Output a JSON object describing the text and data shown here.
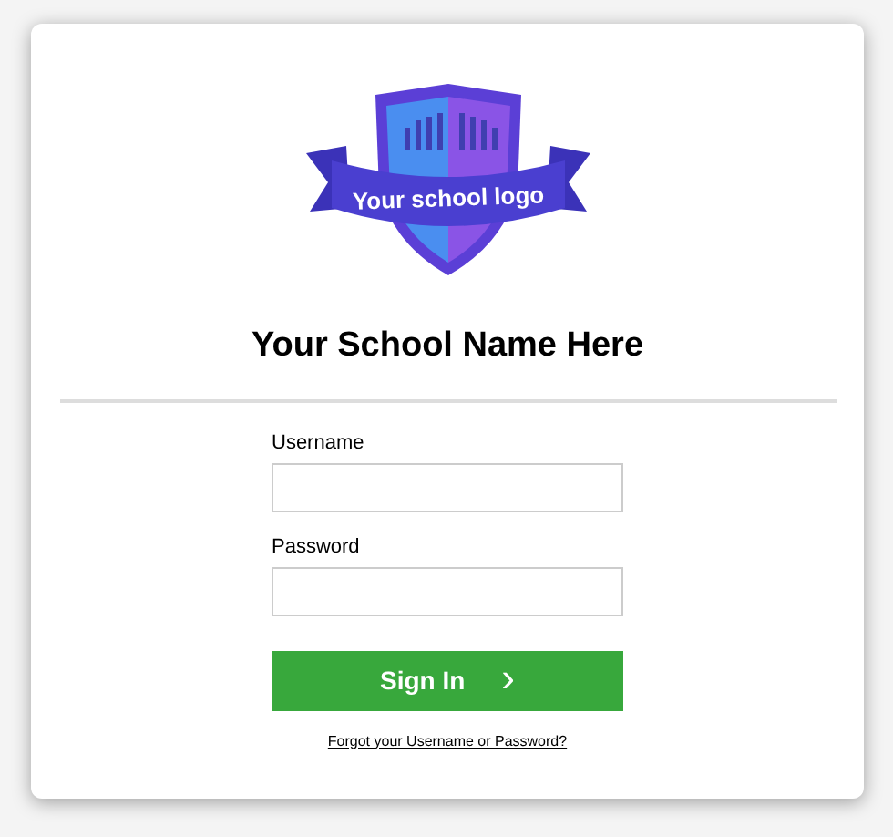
{
  "logo": {
    "text": "Your school logo"
  },
  "title": "Your School Name Here",
  "fields": [
    {
      "label": "Username"
    },
    {
      "label": "Password"
    }
  ],
  "button": {
    "label": "Sign In",
    "icon": "›"
  },
  "link": "Forgot your Username or Password?"
}
